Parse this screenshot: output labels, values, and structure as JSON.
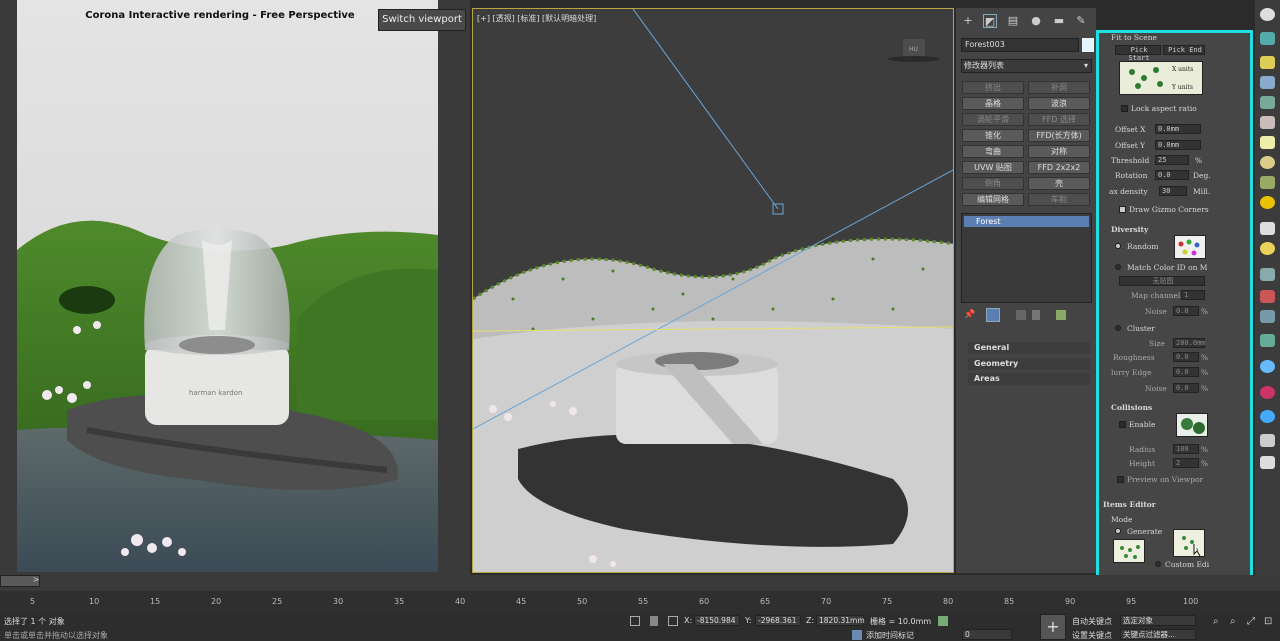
{
  "render": {
    "title": "Corona Interactive rendering - Free Perspective",
    "switch_label": "Switch viewport"
  },
  "viewport": {
    "label": "[+] [透视] [标准] [默认明暗处理]",
    "product_text": "harman kardon"
  },
  "command_panel": {
    "object_name": "Forest003",
    "modifier_list": "修改器列表",
    "modifier_buttons": [
      "挤出",
      "补洞",
      "晶格",
      "波浪",
      "涡轮平滑",
      "FFD 选择",
      "锥化",
      "FFD(长方体)",
      "弯曲",
      "对称",
      "UVW 贴图",
      "FFD 2x2x2",
      "倒角",
      "壳",
      "编辑网格",
      "车削"
    ],
    "stack_item": "Forest",
    "rollouts": [
      "General",
      "Geometry",
      "Areas"
    ]
  },
  "forest_panel": {
    "fit_to_scene": "Fit to Scene",
    "pick_start": "Pick Start",
    "pick_end": "Pick End",
    "x_units": "X units",
    "y_units": "Y units",
    "lock_aspect": "Lock aspect ratio",
    "offset_x_label": "Offset X",
    "offset_x_value": "0.0mm",
    "offset_y_label": "Offset Y",
    "offset_y_value": "0.0mm",
    "threshold_label": "Threshold",
    "threshold_value": "25",
    "threshold_unit": "%",
    "rotation_label": "Rotation",
    "rotation_value": "0.0",
    "rotation_unit": "Deg.",
    "density_label": "ax density",
    "density_value": "30",
    "density_unit": "Mill.",
    "draw_gizmo": "Draw Gizmo Corners",
    "diversity": "Diversity",
    "random": "Random",
    "match_color": "Match Color ID on M",
    "no_map": "无贴图",
    "map_channel_label": "Map channel",
    "map_channel_value": "1",
    "noise_label": "Noise",
    "noise_value": "0.0",
    "cluster": "Cluster",
    "size_label": "Size",
    "size_value": "200.0mm",
    "roughness_label": "Roughness",
    "roughness_value": "0.0",
    "blurry_label": "lurry Edge",
    "blurry_value": "0.0",
    "noise2_label": "Noise",
    "noise2_value": "0.0",
    "collisions": "Collisions",
    "enable": "Enable",
    "radius_label": "Radius",
    "radius_value": "100",
    "height_label": "Height",
    "height_value": "2",
    "preview": "Preview on Viewpor",
    "items_editor": "Items Editor",
    "mode": "Mode",
    "generate": "Generate",
    "custom_edit": "Custom Edi",
    "pct": "%"
  },
  "timeline": {
    "slider": ">",
    "ticks": [
      "5",
      "10",
      "15",
      "20",
      "25",
      "30",
      "35",
      "40",
      "45",
      "50",
      "55",
      "60",
      "65",
      "70",
      "75",
      "80",
      "85",
      "90",
      "95",
      "100"
    ]
  },
  "status": {
    "selected": "选择了 1 个 对象",
    "hint": "单击或单击并拖动以选择对象",
    "x_label": "X:",
    "x_value": "-8150.984",
    "y_label": "Y:",
    "y_value": "-2968.361",
    "z_label": "Z:",
    "z_value": "1820.31mm",
    "grid": "栅格 = 10.0mm",
    "add_time_tag": "添加时间标记",
    "auto_key": "自动关键点",
    "set_key": "设置关键点",
    "selected_obj": "选定对象",
    "key_filters": "关键点过滤器...",
    "frame": "0"
  }
}
